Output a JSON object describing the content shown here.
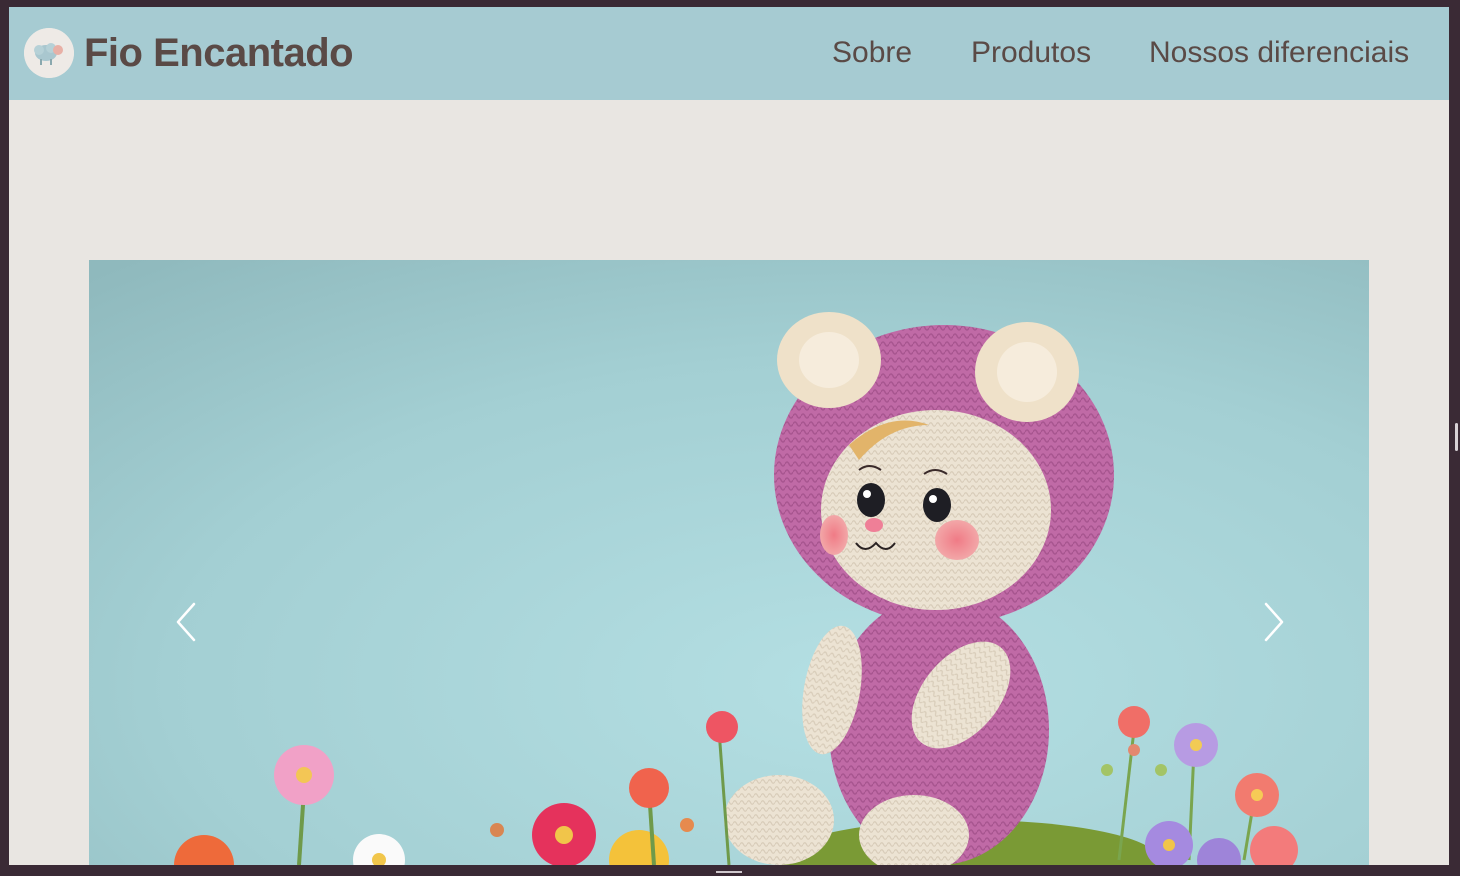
{
  "header": {
    "brand": "Fio Encantado",
    "logo_icon": "sheep-icon",
    "nav": [
      {
        "label": "Sobre"
      },
      {
        "label": "Produtos"
      },
      {
        "label": "Nossos diferenciais"
      }
    ]
  },
  "carousel": {
    "slide_image": "crochet-bear-doll-in-pink-hood-with-flowers",
    "prev_icon": "chevron-left-icon",
    "next_icon": "chevron-right-icon"
  },
  "colors": {
    "navbar": "#a6cbd2",
    "page_background": "#e9e6e2",
    "text": "#5a4a46",
    "window_frame": "#3a2a35"
  }
}
